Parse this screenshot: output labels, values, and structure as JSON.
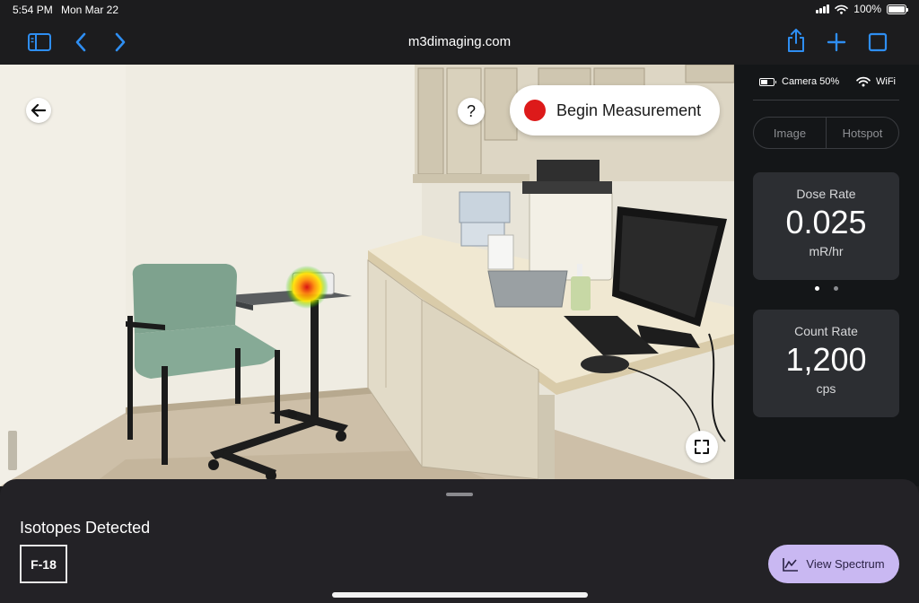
{
  "status_bar": {
    "time": "5:54 PM",
    "date": "Mon Mar 22",
    "battery_label": "100%",
    "battery_level": 1.0,
    "icons": [
      "signal-icon",
      "wifi-icon",
      "battery-icon"
    ]
  },
  "browser": {
    "url": "m3dimaging.com",
    "icons": [
      "sidebar-icon",
      "back-chevron-icon",
      "forward-chevron-icon",
      "share-icon",
      "plus-icon",
      "tabs-icon"
    ]
  },
  "camera_view": {
    "back_icon": "arrow-left-icon",
    "help_label": "?",
    "begin_measurement_label": "Begin Measurement",
    "begin_dot_color": "#dd1a1a",
    "expand_icon": "expand-icon",
    "hotspot_colors": [
      "#d80000",
      "#ff8c00",
      "#ffe600",
      "#00c800"
    ]
  },
  "panel": {
    "camera_status": "Camera 50%",
    "camera_battery_level": 0.5,
    "wifi_label": "WiFi",
    "tabs": [
      {
        "label": "Image"
      },
      {
        "label": "Hotspot"
      }
    ],
    "dose_rate": {
      "label": "Dose Rate",
      "value": "0.025",
      "unit": "mR/hr"
    },
    "count_rate": {
      "label": "Count Rate",
      "value": "1,200",
      "unit": "cps"
    },
    "page_dots": 2,
    "active_dot": 0
  },
  "sheet": {
    "title": "Isotopes Detected",
    "isotopes": [
      "F-18"
    ],
    "spectrum_button_label": "View Spectrum",
    "spectrum_icon": "chart-line-icon",
    "accent": "#c9b8f2"
  }
}
